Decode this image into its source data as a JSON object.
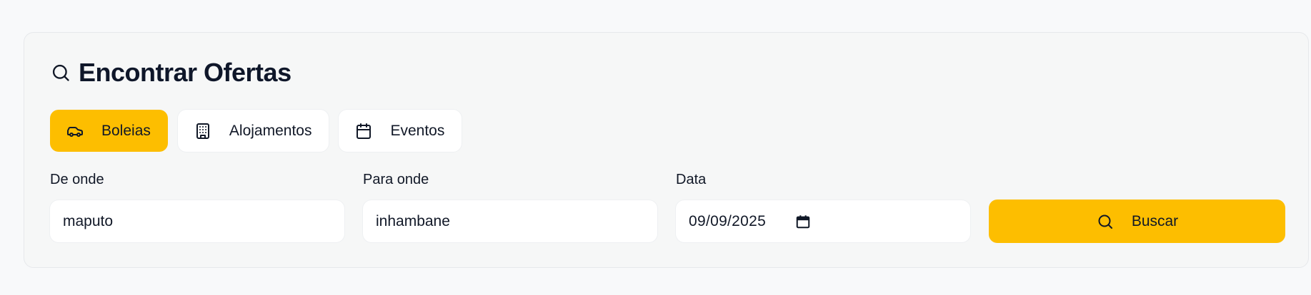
{
  "header": {
    "title": "Encontrar Ofertas",
    "icon": "search-icon"
  },
  "tabs": [
    {
      "label": "Boleias",
      "icon": "car-icon",
      "active": true
    },
    {
      "label": "Alojamentos",
      "icon": "building-icon",
      "active": false
    },
    {
      "label": "Eventos",
      "icon": "calendar-icon",
      "active": false
    }
  ],
  "fields": {
    "from": {
      "label": "De onde",
      "value": "maputo"
    },
    "to": {
      "label": "Para onde",
      "value": "inhambane"
    },
    "date": {
      "label": "Data",
      "value": "09/09/2025"
    }
  },
  "search_button": {
    "label": "Buscar",
    "icon": "search-icon"
  },
  "colors": {
    "accent": "#fdbe00",
    "background": "#f8f9fa",
    "card": "#f6f7f7",
    "input": "#ffffff",
    "text": "#111827"
  }
}
